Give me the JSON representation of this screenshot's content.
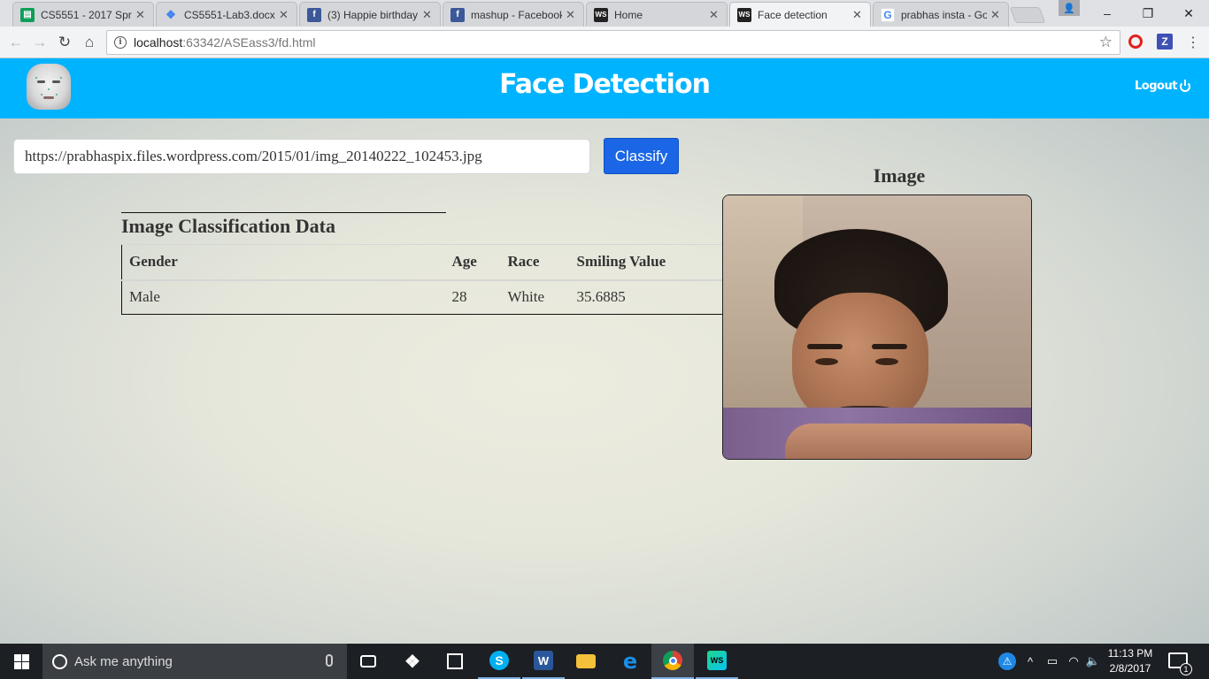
{
  "browser": {
    "tabs": [
      {
        "title": "CS5551 - 2017 Spr",
        "favicon": "sheets-icon",
        "color": "#0f9d58"
      },
      {
        "title": "CS5551-Lab3.docx",
        "favicon": "dropbox-icon",
        "color": "#3d82f0"
      },
      {
        "title": "(3) Happie birthday",
        "favicon": "facebook-icon",
        "color": "#3b5998"
      },
      {
        "title": "mashup - Facebook",
        "favicon": "facebook-icon",
        "color": "#3b5998"
      },
      {
        "title": "Home",
        "favicon": "webstorm-icon",
        "color": "#222222"
      },
      {
        "title": "Face detection",
        "favicon": "webstorm-icon",
        "color": "#222222",
        "active": true
      },
      {
        "title": "prabhas insta - Go",
        "favicon": "google-icon",
        "color": "#ffffff"
      }
    ],
    "address": {
      "host": "localhost",
      "path": ":63342/ASEass3/fd.html"
    }
  },
  "app": {
    "header_color": "#00b3ff",
    "title": "Face Detection",
    "logout_label": "Logout",
    "url_input_value": "https://prabhaspix.files.wordpress.com/2015/01/img_20140222_102453.jpg",
    "classify_label": "Classify",
    "table": {
      "caption": "Image Classification Data",
      "headers": {
        "gender": "Gender",
        "age": "Age",
        "race": "Race",
        "smiling": "Smiling Value"
      },
      "row": {
        "gender": "Male",
        "age": "28",
        "race": "White",
        "smiling": "35.6885"
      }
    },
    "image_heading": "Image"
  },
  "taskbar": {
    "search_placeholder": "Ask me anything",
    "time": "11:13 PM",
    "date": "2/8/2017",
    "notification_count": "1"
  }
}
